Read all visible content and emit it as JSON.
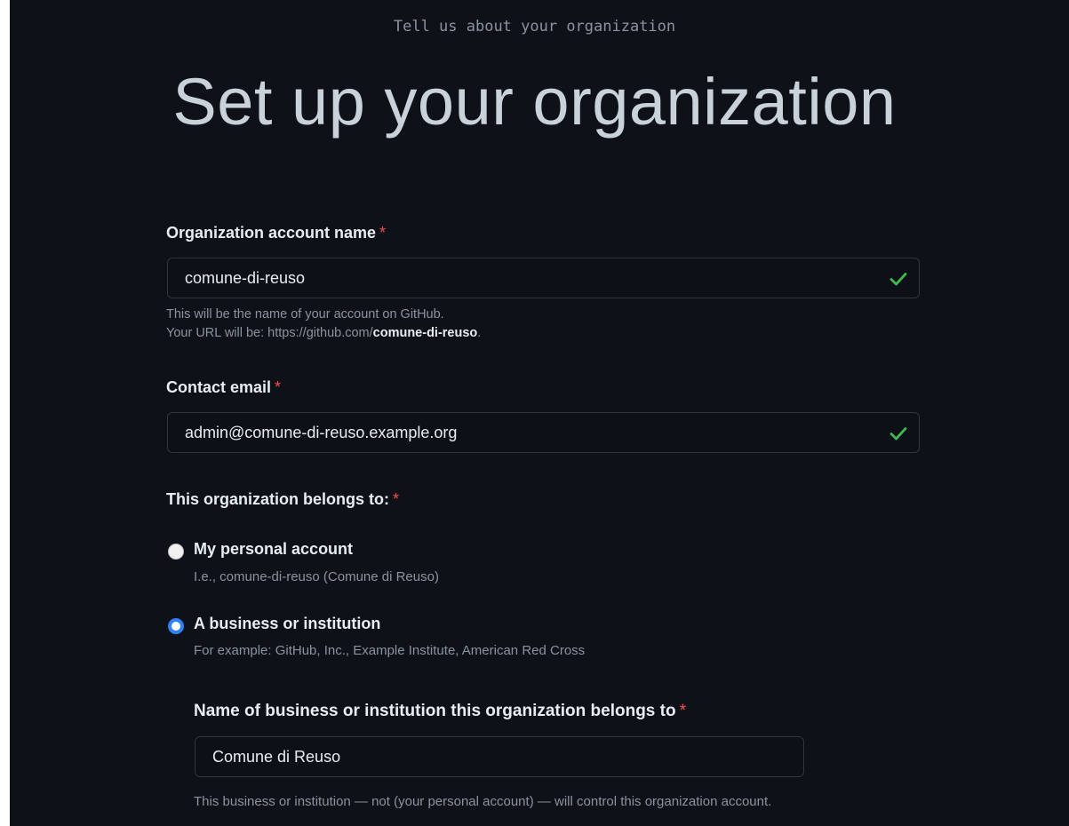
{
  "header": {
    "eyebrow": "Tell us about your organization",
    "title": "Set up your organization"
  },
  "org_name": {
    "label": "Organization account name",
    "required_mark": "*",
    "value": "comune-di-reuso",
    "hint_line1": "This will be the name of your account on GitHub.",
    "hint_url_prefix": "Your URL will be: https://github.com/",
    "hint_url_name": "comune-di-reuso",
    "hint_url_suffix": ".",
    "valid_icon": "check-icon"
  },
  "contact_email": {
    "label": "Contact email",
    "required_mark": "*",
    "value": "admin@comune-di-reuso.example.org",
    "valid_icon": "check-icon"
  },
  "belongs_to": {
    "label": "This organization belongs to:",
    "required_mark": "*",
    "options": [
      {
        "title": "My personal account",
        "description": "I.e., comune-di-reuso (Comune di Reuso)",
        "selected": false
      },
      {
        "title": "A business or institution",
        "description": "For example: GitHub, Inc., Example Institute, American Red Cross",
        "selected": true
      }
    ]
  },
  "business_name": {
    "label": "Name of business or institution this organization belongs to",
    "required_mark": "*",
    "value": "Comune di Reuso",
    "hint": "This business or institution — not (your personal account) — will control this organization account."
  },
  "colors": {
    "background": "#0e1117",
    "valid_check": "#3fb950",
    "required": "#f85149",
    "radio_accent": "#2f81f7"
  }
}
